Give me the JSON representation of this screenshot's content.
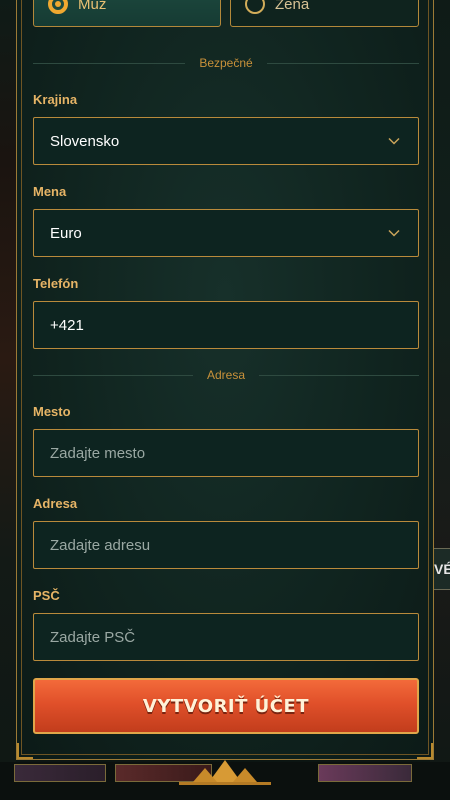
{
  "gender": {
    "male_label": "Muž",
    "female_label": "Žena",
    "selected": "male"
  },
  "sections": {
    "secure": "Bezpečné",
    "address": "Adresa"
  },
  "country": {
    "label": "Krajina",
    "value": "Slovensko"
  },
  "currency": {
    "label": "Mena",
    "value": "Euro"
  },
  "phone": {
    "label": "Telefón",
    "value": "+421"
  },
  "city": {
    "label": "Mesto",
    "placeholder": "Zadajte mesto"
  },
  "street": {
    "label": "Adresa",
    "placeholder": "Zadajte adresu"
  },
  "zip": {
    "label": "PSČ",
    "placeholder": "Zadajte PSČ"
  },
  "submit": {
    "label": "VYTVORIŤ ÚČET"
  },
  "background": {
    "right_tab_text": "VÉ"
  },
  "colors": {
    "accent": "#b98a3b",
    "cta": "#e0502a",
    "panel": "#10241f"
  }
}
